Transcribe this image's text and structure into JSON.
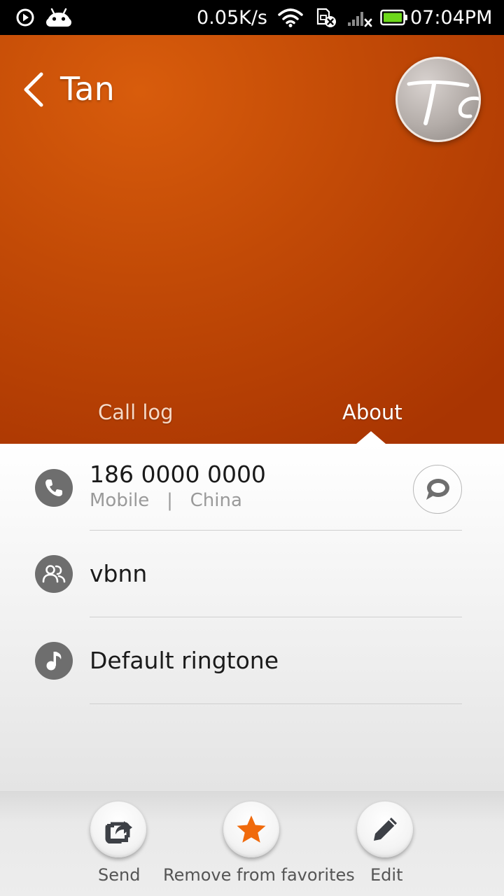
{
  "status_bar": {
    "network_speed": "0.05K/s",
    "time": "07:04PM",
    "icons": [
      "play-circle-icon",
      "android-icon",
      "wifi-icon",
      "sim-card-no-signal-icon",
      "signal-bars-icon",
      "battery-icon"
    ],
    "battery_color": "#6dd81a"
  },
  "header": {
    "contact_name": "Tan",
    "avatar_initials": "Ta",
    "tabs": [
      {
        "label": "Call log",
        "active": false
      },
      {
        "label": "About",
        "active": true
      }
    ],
    "accent_color": "#c24a06"
  },
  "details": {
    "phone": {
      "number": "186 0000 0000",
      "type": "Mobile",
      "separator": "|",
      "location": "China"
    },
    "group": {
      "label": "vbnn"
    },
    "ringtone": {
      "label": "Default ringtone"
    }
  },
  "actions": [
    {
      "label": "Send",
      "icon": "share-icon"
    },
    {
      "label": "Remove from favorites",
      "icon": "star-icon",
      "icon_color": "#f06a0c"
    },
    {
      "label": "Edit",
      "icon": "pencil-icon"
    }
  ]
}
